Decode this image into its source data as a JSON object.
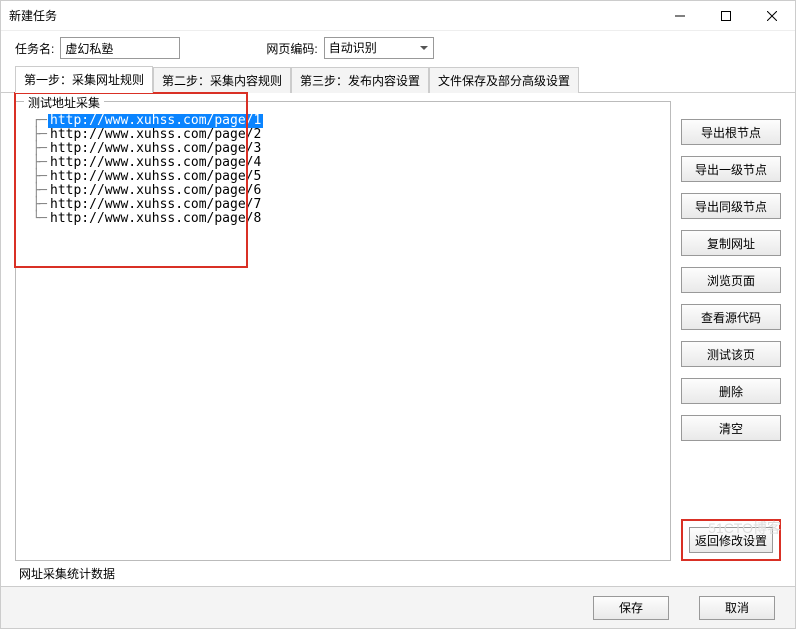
{
  "window": {
    "title": "新建任务"
  },
  "form": {
    "task_name_label": "任务名:",
    "task_name_value": "虚幻私塾",
    "encoding_label": "网页编码:",
    "encoding_value": "自动识别"
  },
  "tabs": [
    {
      "label": "第一步：采集网址规则",
      "selected": true
    },
    {
      "label": "第二步：采集内容规则",
      "selected": false
    },
    {
      "label": "第三步：发布内容设置",
      "selected": false
    },
    {
      "label": "文件保存及部分高级设置",
      "selected": false
    }
  ],
  "groupbox": {
    "title": "测试地址采集"
  },
  "urls": [
    {
      "text": "http://www.xuhss.com/page/1",
      "selected": true
    },
    {
      "text": "http://www.xuhss.com/page/2",
      "selected": false
    },
    {
      "text": "http://www.xuhss.com/page/3",
      "selected": false
    },
    {
      "text": "http://www.xuhss.com/page/4",
      "selected": false
    },
    {
      "text": "http://www.xuhss.com/page/5",
      "selected": false
    },
    {
      "text": "http://www.xuhss.com/page/6",
      "selected": false
    },
    {
      "text": "http://www.xuhss.com/page/7",
      "selected": false
    },
    {
      "text": "http://www.xuhss.com/page/8",
      "selected": false
    }
  ],
  "side_buttons": {
    "export_root": "导出根节点",
    "export_level1": "导出一级节点",
    "export_sibling": "导出同级节点",
    "copy_url": "复制网址",
    "browse_page": "浏览页面",
    "view_source": "查看源代码",
    "test_page": "测试该页",
    "delete": "删除",
    "clear": "清空",
    "back_modify": "返回修改设置"
  },
  "stats_label": "网址采集统计数据",
  "footer": {
    "save": "保存",
    "cancel": "取消"
  },
  "watermark": "51CTO博客"
}
